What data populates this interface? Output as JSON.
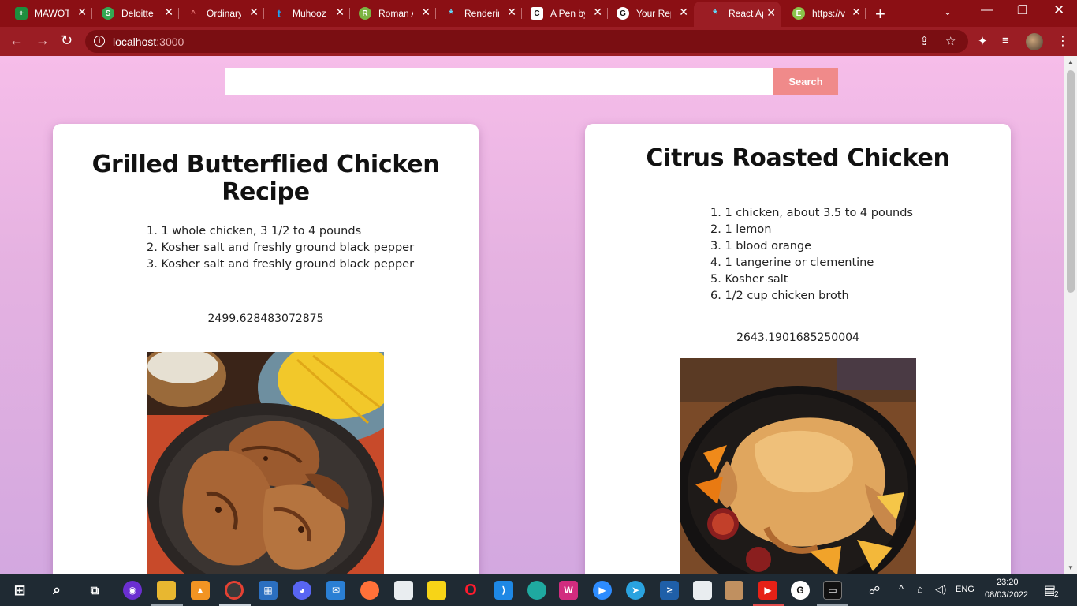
{
  "browser": {
    "tabs": [
      {
        "title": "MAWOT",
        "favicon_color": "#1e8e3e",
        "favicon_glyph": "+"
      },
      {
        "title": "Deloitte",
        "favicon_color": "#34a853",
        "favicon_glyph": "S"
      },
      {
        "title": "Ordinary",
        "favicon_color": "#8b0f14",
        "favicon_glyph": "^"
      },
      {
        "title": "Muhooz",
        "favicon_color": "#1da1f2",
        "favicon_glyph": "t"
      },
      {
        "title": "Roman A",
        "favicon_color": "#7cb342",
        "favicon_glyph": "R"
      },
      {
        "title": "Renderin",
        "favicon_color": "#61dafb",
        "favicon_glyph": "*"
      },
      {
        "title": "A Pen by",
        "favicon_color": "#111111",
        "favicon_glyph": "C"
      },
      {
        "title": "Your Rep",
        "favicon_color": "#111111",
        "favicon_glyph": "G"
      },
      {
        "title": "React Ap",
        "favicon_color": "#61dafb",
        "favicon_glyph": "*",
        "active": true
      },
      {
        "title": "https://v",
        "favicon_color": "#8bc34a",
        "favicon_glyph": "E"
      }
    ],
    "url_host": "localhost",
    "url_port": ":3000",
    "accent_color": "#9b1d24"
  },
  "search": {
    "value": "",
    "placeholder": "",
    "button_label": "Search",
    "button_color": "#f08a8a"
  },
  "recipes": [
    {
      "title": "Grilled Butterflied Chicken Recipe",
      "ingredients": [
        "1. 1 whole chicken, 3 1/2 to 4 pounds",
        "2. Kosher salt and freshly ground black pepper",
        "3. Kosher salt and freshly ground black pepper"
      ],
      "calories": "2499.628483072875",
      "image_name": "grilled-chicken-photo"
    },
    {
      "title": "Citrus Roasted Chicken",
      "ingredients": [
        "1. 1 chicken, about 3.5 to 4 pounds",
        "2. 1 lemon",
        "3. 1 blood orange",
        "4. 1 tangerine or clementine",
        "5. Kosher salt",
        "6. 1/2 cup chicken broth"
      ],
      "calories": "2643.1901685250004",
      "image_name": "roasted-chicken-photo"
    }
  ],
  "taskbar": {
    "language": "ENG",
    "time": "23:20",
    "date": "08/03/2022",
    "notification_count": "2"
  }
}
